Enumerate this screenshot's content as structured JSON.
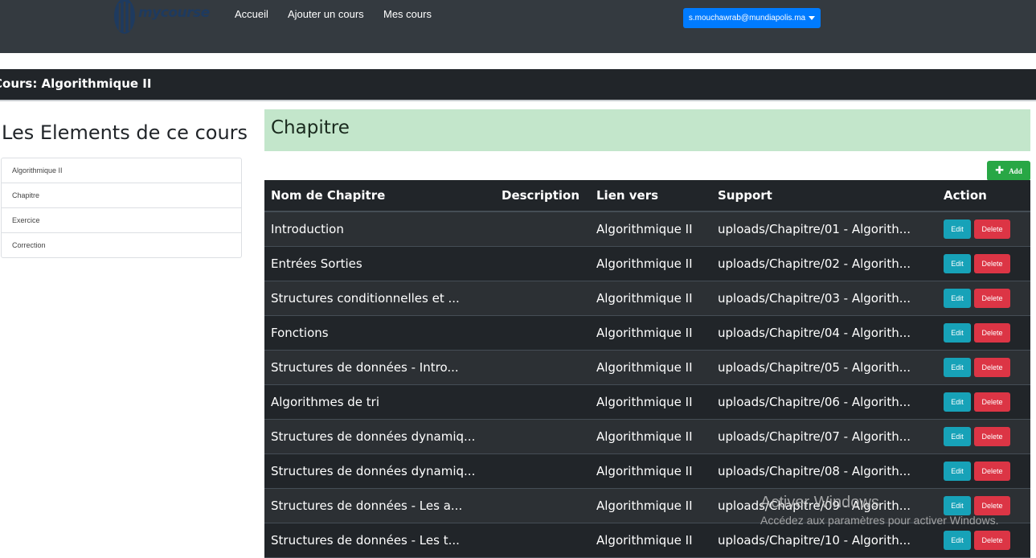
{
  "navbar": {
    "brand": "mycourse",
    "links": [
      "Accueil",
      "Ajouter un cours",
      "Mes cours"
    ],
    "user_email": "s.mouchawrab@mundiapolis.ma"
  },
  "course": {
    "title": "Cours: Algorithmique II"
  },
  "sidebar": {
    "heading": "Les Elements de ce cours",
    "items": [
      "Algorithmique II",
      "Chapitre",
      "Exercice",
      "Correction"
    ]
  },
  "main": {
    "section_title": "Chapitre",
    "add_label": "Add",
    "columns": [
      "Nom de Chapitre",
      "Description",
      "Lien vers",
      "Support",
      "Action"
    ],
    "rows": [
      {
        "nom": "Introduction",
        "description": "",
        "lien": "Algorithmique II",
        "support": "uploads/Chapitre/01 - Algorith..."
      },
      {
        "nom": "Entrées Sorties",
        "description": "",
        "lien": "Algorithmique II",
        "support": "uploads/Chapitre/02 - Algorith..."
      },
      {
        "nom": "Structures conditionnelles et ...",
        "description": "",
        "lien": "Algorithmique II",
        "support": "uploads/Chapitre/03 - Algorith..."
      },
      {
        "nom": "Fonctions",
        "description": "",
        "lien": "Algorithmique II",
        "support": "uploads/Chapitre/04 - Algorith..."
      },
      {
        "nom": "Structures de données - Intro...",
        "description": "",
        "lien": "Algorithmique II",
        "support": "uploads/Chapitre/05 - Algorith..."
      },
      {
        "nom": "Algorithmes de tri",
        "description": "",
        "lien": "Algorithmique II",
        "support": "uploads/Chapitre/06 - Algorith..."
      },
      {
        "nom": "Structures de données dynamiq...",
        "description": "",
        "lien": "Algorithmique II",
        "support": "uploads/Chapitre/07 - Algorith..."
      },
      {
        "nom": "Structures de données dynamiq...",
        "description": "",
        "lien": "Algorithmique II",
        "support": "uploads/Chapitre/08 - Algorith..."
      },
      {
        "nom": "Structures de données - Les a...",
        "description": "",
        "lien": "Algorithmique II",
        "support": "uploads/Chapitre/09 - Algorith..."
      },
      {
        "nom": "Structures de données - Les t...",
        "description": "",
        "lien": "Algorithmique II",
        "support": "uploads/Chapitre/10 - Algorith..."
      }
    ],
    "edit_label": "Edit",
    "delete_label": "Delete"
  },
  "watermark": {
    "line1": "Activer Windows",
    "line2": "Accédez aux paramètres pour activer Windows."
  },
  "colors": {
    "navbar": "#343a40",
    "primary": "#007bff",
    "success": "#28a745",
    "info": "#17a2b8",
    "danger": "#dc3545",
    "table_dark": "#212529",
    "section_header": "#c3e6cb"
  }
}
